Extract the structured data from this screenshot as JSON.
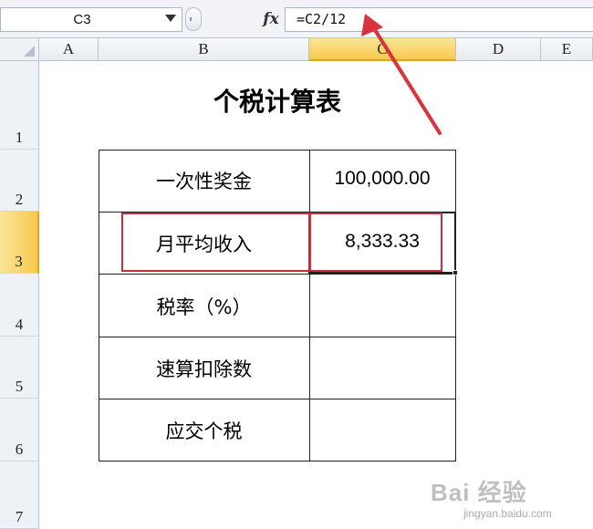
{
  "formula_bar": {
    "name_box": "C3",
    "fx_label": "fx",
    "formula": "=C2/12"
  },
  "columns": [
    "A",
    "B",
    "C",
    "D",
    "E"
  ],
  "rows": [
    "1",
    "2",
    "3",
    "4",
    "5",
    "6",
    "7"
  ],
  "selected": {
    "column": "C",
    "row": "3"
  },
  "sheet": {
    "title": "个税计算表",
    "table": [
      {
        "label": "一次性奖金",
        "value": "100,000.00"
      },
      {
        "label": "月平均收入",
        "value": "8,333.33"
      },
      {
        "label": "税率（%）",
        "value": ""
      },
      {
        "label": "速算扣除数",
        "value": ""
      },
      {
        "label": "应交个税",
        "value": ""
      }
    ]
  },
  "annotation": {
    "color": "#d9343e"
  },
  "watermark": {
    "main": "Bai 经验",
    "sub": "jingyan.baidu.com"
  }
}
